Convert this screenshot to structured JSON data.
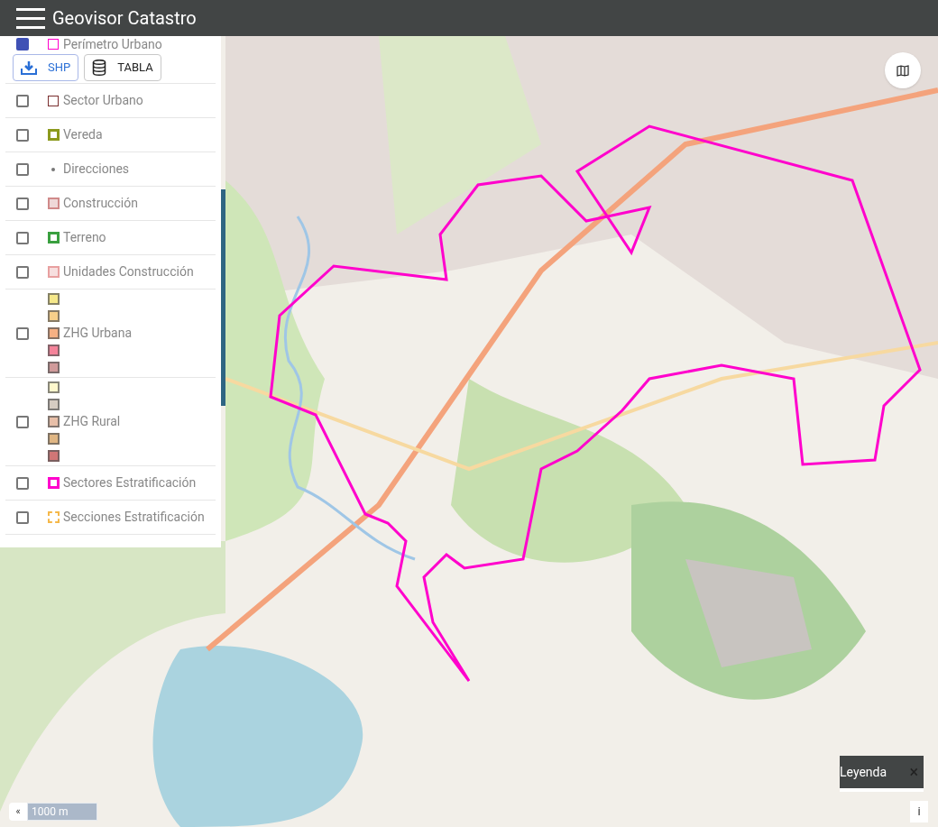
{
  "header": {
    "title": "Geovisor Catastro"
  },
  "layers": [
    {
      "label": "Perímetro Urbano",
      "checked": true,
      "kind": "outline",
      "color": "#ff00cc"
    },
    {
      "label": "Sector Urbano",
      "checked": false,
      "kind": "outline",
      "color": "#7a2e2e"
    },
    {
      "label": "Vereda",
      "checked": false,
      "kind": "thick",
      "color": "#8c9a1e"
    },
    {
      "label": "Direcciones",
      "checked": false,
      "kind": "dot",
      "color": "#777777"
    },
    {
      "label": "Construcción",
      "checked": false,
      "kind": "fill",
      "color": "#d08a8a"
    },
    {
      "label": "Terreno",
      "checked": false,
      "kind": "thick",
      "color": "#3aa040"
    },
    {
      "label": "Unidades Construcción",
      "checked": false,
      "kind": "fill",
      "color": "#e8a0a0"
    },
    {
      "label": "ZHG Urbana",
      "checked": false,
      "kind": "swatches",
      "swatches": [
        {
          "color": "#f5e88a"
        },
        {
          "color": "#f7cf8a"
        },
        {
          "color": "#f7b083"
        },
        {
          "color": "#f5839a"
        },
        {
          "color": "#d09a9a"
        }
      ]
    },
    {
      "label": "ZHG Rural",
      "checked": false,
      "kind": "swatches",
      "swatches": [
        {
          "color": "#fff8cc"
        },
        {
          "color": "#d6ccc2"
        },
        {
          "color": "#e8bfa8"
        },
        {
          "color": "#e0b683"
        },
        {
          "color": "#d07676"
        }
      ]
    },
    {
      "label": "Sectores Estratificación",
      "checked": false,
      "kind": "thick",
      "color": "#ff00cc"
    },
    {
      "label": "Secciones Estratificación",
      "checked": false,
      "kind": "dashed",
      "color": "#f5b84a"
    }
  ],
  "buttons": [
    "SHP",
    "TABLA"
  ],
  "legend": {
    "label": "Leyenda",
    "close": "×"
  },
  "scale": {
    "collapse": "«",
    "label": "1000 m"
  },
  "info": "i"
}
